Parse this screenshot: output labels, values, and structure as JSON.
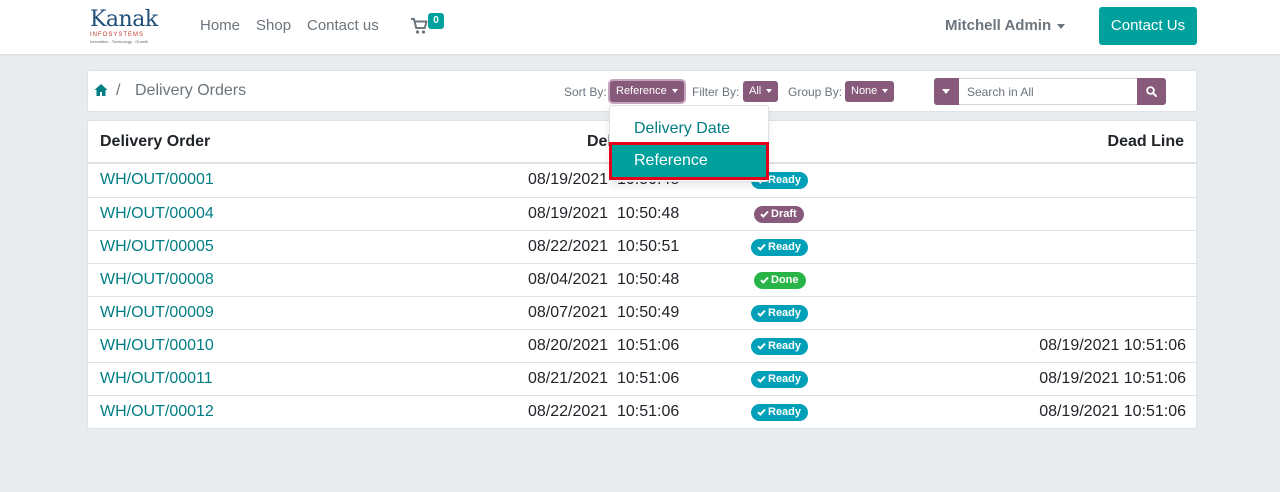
{
  "header": {
    "logo": {
      "main": "Kanak",
      "sub": "INFOSYSTEMS",
      "tagline": "Innovation . Technology . Growth"
    },
    "nav": [
      {
        "label": "Home"
      },
      {
        "label": "Shop"
      },
      {
        "label": "Contact us"
      }
    ],
    "cart": {
      "icon": "shopping-cart-icon",
      "count": "0"
    },
    "user": {
      "name": "Mitchell Admin"
    },
    "contact_button": "Contact Us"
  },
  "breadcrumb": {
    "home_icon": "home-icon",
    "separator": "/",
    "current": "Delivery Orders"
  },
  "controls": {
    "sort": {
      "label": "Sort By:",
      "value": "Reference"
    },
    "filter": {
      "label": "Filter By:",
      "value": "All"
    },
    "group": {
      "label": "Group By:",
      "value": "None"
    },
    "search": {
      "placeholder": "Search in All",
      "icon": "search-icon"
    }
  },
  "sort_dropdown": {
    "options": [
      {
        "label": "Delivery Date"
      },
      {
        "label": "Reference"
      }
    ],
    "selected": "Reference"
  },
  "table": {
    "columns": {
      "order": "Delivery Order",
      "date": "Delivery Date",
      "deadline": "Dead Line"
    },
    "rows": [
      {
        "ref": "WH/OUT/00001",
        "date": "08/19/2021  10:50:48",
        "status": "Ready",
        "deadline": ""
      },
      {
        "ref": "WH/OUT/00004",
        "date": "08/19/2021  10:50:48",
        "status": "Draft",
        "deadline": ""
      },
      {
        "ref": "WH/OUT/00005",
        "date": "08/22/2021  10:50:51",
        "status": "Ready",
        "deadline": ""
      },
      {
        "ref": "WH/OUT/00008",
        "date": "08/04/2021  10:50:48",
        "status": "Done",
        "deadline": ""
      },
      {
        "ref": "WH/OUT/00009",
        "date": "08/07/2021  10:50:49",
        "status": "Ready",
        "deadline": ""
      },
      {
        "ref": "WH/OUT/00010",
        "date": "08/20/2021  10:51:06",
        "status": "Ready",
        "deadline": "08/19/2021 10:51:06"
      },
      {
        "ref": "WH/OUT/00011",
        "date": "08/21/2021  10:51:06",
        "status": "Ready",
        "deadline": "08/19/2021 10:51:06"
      },
      {
        "ref": "WH/OUT/00012",
        "date": "08/22/2021  10:51:06",
        "status": "Ready",
        "deadline": "08/19/2021 10:51:06"
      }
    ]
  },
  "colors": {
    "accent": "#00a09d",
    "primary": "#875a7b",
    "link": "#017e84",
    "status_ready": "#00a0b8",
    "status_draft": "#875a7b",
    "status_done": "#28b446",
    "highlight": "#e4001b"
  }
}
